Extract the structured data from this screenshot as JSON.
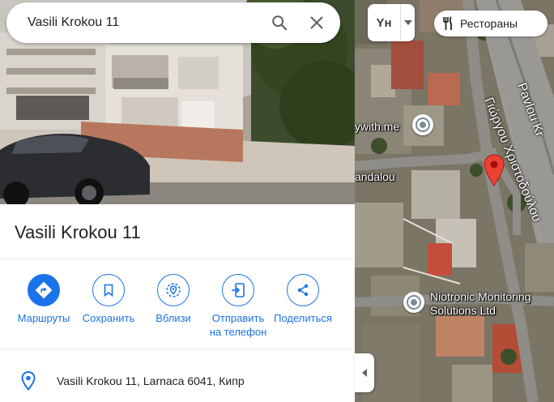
{
  "search": {
    "query": "Vasili Krokou 11",
    "search_icon": "search-icon",
    "clear_icon": "close-icon"
  },
  "place": {
    "title": "Vasili Krokou 11",
    "address": "Vasili Krokou 11, Larnaca 6041, Кипр"
  },
  "actions": [
    {
      "label": "Маршруты",
      "icon": "directions-icon"
    },
    {
      "label": "Сохранить",
      "icon": "bookmark-icon"
    },
    {
      "label": "Вблизи",
      "icon": "nearby-icon"
    },
    {
      "label": "Отправить\nна телефон",
      "icon": "send-to-phone-icon"
    },
    {
      "label": "Поделиться",
      "icon": "share-icon"
    }
  ],
  "map": {
    "language_toggle": "Υн",
    "restaurants_chip": "Рестораны",
    "labels": {
      "poi1": "ywith.me",
      "street1": "andalou",
      "poi2_line1": "Niotronic Monitoring",
      "poi2_line2": "Solutions Ltd",
      "street_greek": "Γιώργου Χριστοδούλου",
      "street_pavlou": "Pavlou Kr"
    }
  },
  "colors": {
    "accent": "#1a73e8",
    "pin_red": "#ea4335",
    "text": "#202124"
  }
}
